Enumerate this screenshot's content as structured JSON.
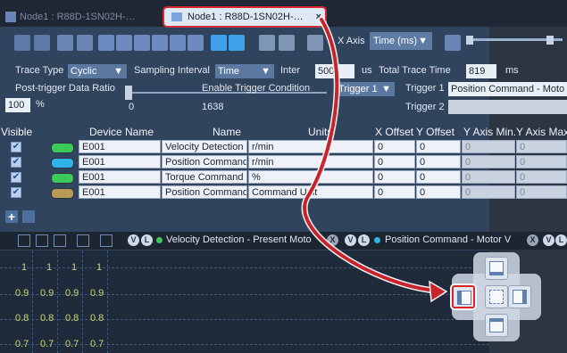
{
  "tabs": [
    {
      "label": "Node1 : R88D-1SN02H-…",
      "active": false
    },
    {
      "label": "Node1 : R88D-1SN02H-…",
      "active": true,
      "close": "×"
    }
  ],
  "toolbar": {
    "x_axis_label": "X Axis",
    "x_axis_value": "Time (ms)"
  },
  "settings": {
    "trace_type_label": "Trace Type",
    "trace_type_value": "Cyclic",
    "sampling_interval_label": "Sampling Interval",
    "sampling_interval_value": "Time",
    "interval_label": "Inter",
    "interval_value": "500",
    "interval_unit": "us",
    "total_trace_time_label": "Total Trace Time",
    "total_trace_time_value": "819",
    "total_trace_time_unit": "ms",
    "post_trigger_label": "Post-trigger Data Ratio",
    "post_trigger_value": "100",
    "post_trigger_unit": "%",
    "ratio_min": "0",
    "ratio_max": "1638",
    "enable_trigger_label": "Enable Trigger Condition",
    "trigger_select": "Trigger 1",
    "trigger1_label": "Trigger 1",
    "trigger1_value": "Position Command - Moto",
    "trigger2_label": "Trigger 2"
  },
  "table": {
    "headers": [
      "Visible",
      "Device Name",
      "Name",
      "Units",
      "X Offset",
      "Y Offset",
      "Y Axis Min.",
      "Y Axis Max"
    ],
    "rows": [
      {
        "device": "E001",
        "name": "Velocity Detection - Present V",
        "units": "r/min",
        "xoff": "0",
        "yoff": "0",
        "ymin": "0",
        "ymax": "0",
        "color": "#3cc85a"
      },
      {
        "device": "E001",
        "name": "Position Command - Motor V",
        "units": "r/min",
        "xoff": "0",
        "yoff": "0",
        "ymin": "0",
        "ymax": "0",
        "color": "#2fb4ea"
      },
      {
        "device": "E001",
        "name": "Torque Command - Torque (",
        "units": "%",
        "xoff": "0",
        "yoff": "0",
        "ymin": "0",
        "ymax": "0",
        "color": "#3cc85a"
      },
      {
        "device": "E001",
        "name": "Position Command - Followi",
        "units": "Command Unit",
        "xoff": "0",
        "yoff": "0",
        "ymin": "0",
        "ymax": "0",
        "color": "#b89a55"
      }
    ],
    "check": "✔"
  },
  "plot": {
    "series1": "Velocity Detection - Present Moto",
    "series2": "Position Command - Motor V",
    "ticks_top": [
      "1",
      "1",
      "1",
      "1"
    ],
    "ticks_09": [
      "0.9",
      "0.9",
      "0.9",
      "0.9"
    ],
    "ticks_08": [
      "0.8",
      "0.8",
      "0.8",
      "0.8"
    ],
    "ticks_07": [
      "0.7",
      "0.7",
      "0.7",
      "0.7"
    ]
  },
  "colors": {
    "accent_red": "#d7262b",
    "dot_green": "#3cc85a",
    "dot_blue": "#2fb4ea"
  }
}
